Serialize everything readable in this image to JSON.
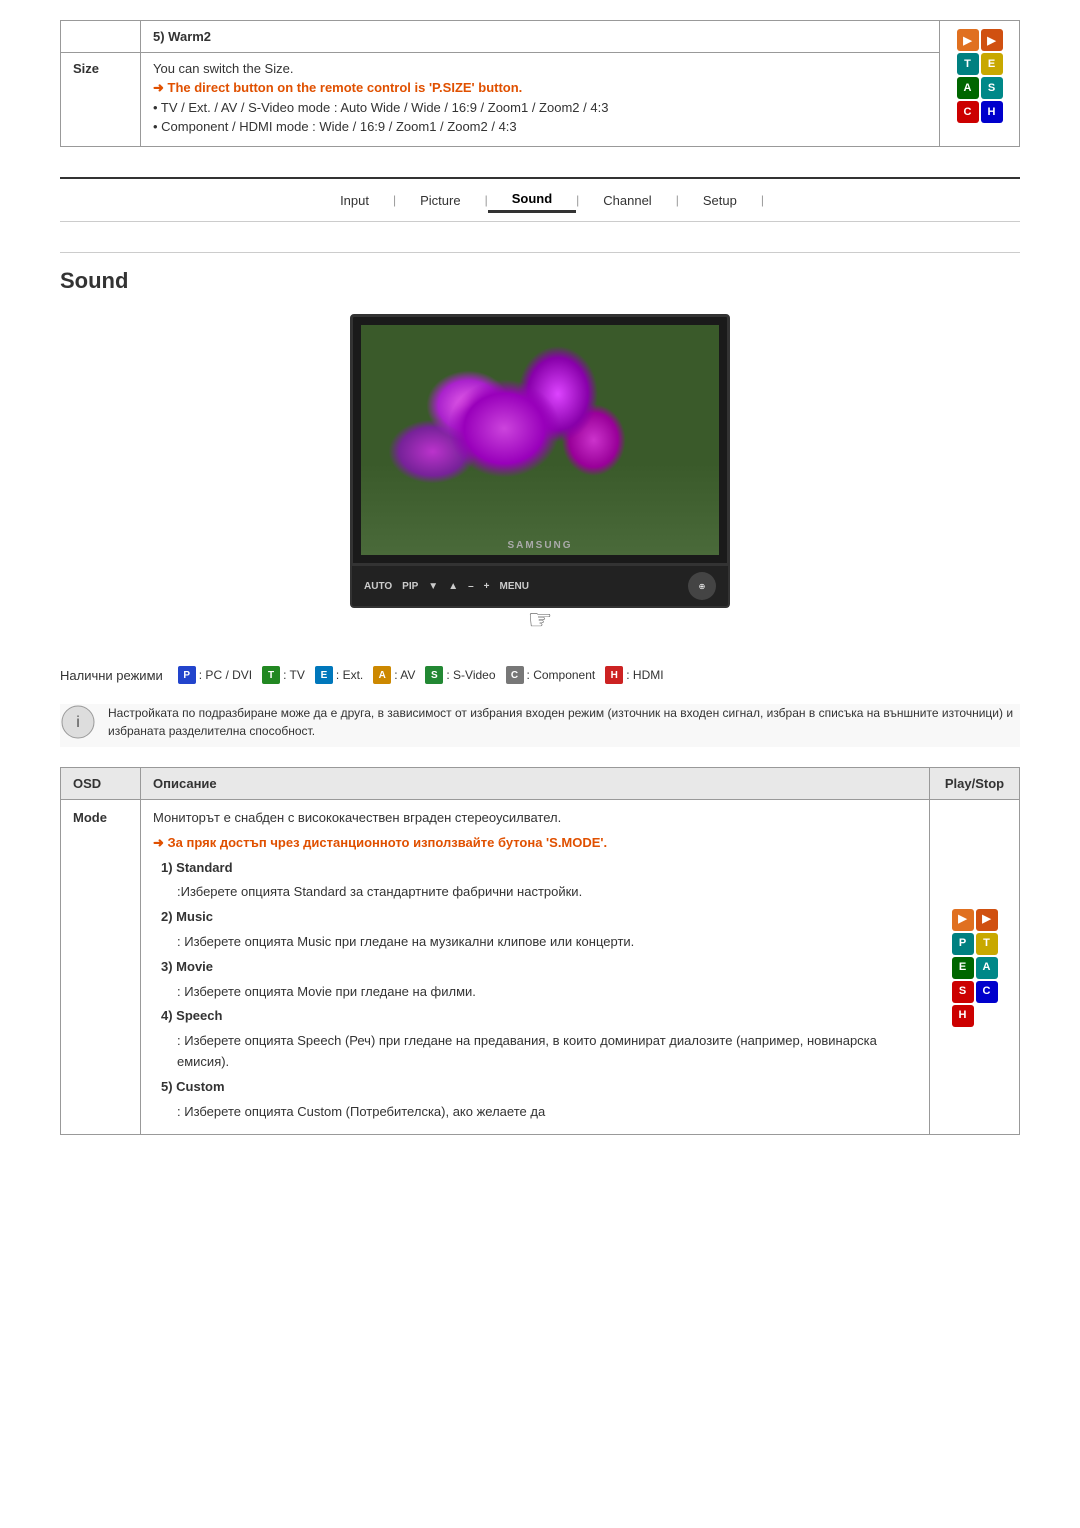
{
  "top_section": {
    "warm2_label": "5) Warm2",
    "size_label": "Size",
    "size_intro": "You can switch the Size.",
    "size_direct": "➜ The direct button on the remote control is 'P.SIZE' button.",
    "size_tv": "• TV / Ext. / AV / S-Video mode : Auto Wide / Wide / 16:9 / Zoom1 / Zoom2 / 4:3",
    "size_hdmi": "• Component / HDMI mode : Wide / 16:9 / Zoom1 / Zoom2 / 4:3",
    "badges_top": [
      {
        "letter": "▶▶",
        "class": "badge-orange"
      },
      {
        "letter": "",
        "class": "badge-orange2"
      },
      {
        "letter": "T",
        "class": "badge-teal"
      },
      {
        "letter": "E",
        "class": "badge-yellow"
      },
      {
        "letter": "A",
        "class": "badge-green"
      },
      {
        "letter": "S",
        "class": "badge-cyan"
      },
      {
        "letter": "C",
        "class": "badge-red"
      },
      {
        "letter": "H",
        "class": "badge-blue"
      }
    ]
  },
  "nav": {
    "items": [
      "Input",
      "Picture",
      "Sound",
      "Channel",
      "Setup"
    ],
    "active": "Sound"
  },
  "section_title": "Sound",
  "tv_brand": "SAMSUNG",
  "tv_controls": [
    "AUTO",
    "PIP",
    "▼",
    "▲",
    "–",
    "+",
    "MENU"
  ],
  "modes_section": {
    "label": "Налични режими",
    "items": [
      {
        "icon": "P",
        "class": "icon-p",
        "text": ": PC / DVI"
      },
      {
        "icon": "T",
        "class": "icon-t",
        "text": ": TV"
      },
      {
        "icon": "E",
        "class": "icon-e",
        "text": ": Ext."
      },
      {
        "icon": "A",
        "class": "icon-a",
        "text": ": AV"
      },
      {
        "icon": "S",
        "class": "icon-s",
        "text": ": S-Video"
      },
      {
        "icon": "C",
        "class": "icon-c",
        "text": ": Component"
      },
      {
        "icon": "H",
        "class": "icon-h",
        "text": ": HDMI"
      }
    ]
  },
  "note_text": "Настройката по подразбиране може да е друга, в зависимост от избрания входен режим (източник на входен сигнал, избран в списъка на външните източници) и избраната разделителна способност.",
  "table": {
    "headers": [
      "OSD",
      "Описание",
      "Play/Stop"
    ],
    "rows": [
      {
        "osd": "Mode",
        "desc_lines": [
          "Мониторът е снабден с висококачествен вграден стереоусилвател.",
          "➜ За пряк достъп чрез дистанционното използвайте бутона 'S.MODE'.",
          "1) Standard",
          ":Изберете опцията Standard за стандартните фабрични настройки.",
          "2) Music",
          ": Изберете опцията Music при гледане на музикални клипове или концерти.",
          "3) Movie",
          ": Изберете опцията Movie при гледане на филми.",
          "4) Speech",
          ": Изберете опцията Speech (Реч) при гледане на предавания, в които доминират диалозите (например, новинарска емисия).",
          "5) Custom",
          ": Изберете опцията Custom (Потребителска), ако желаете да"
        ],
        "has_badge": true
      }
    ]
  }
}
